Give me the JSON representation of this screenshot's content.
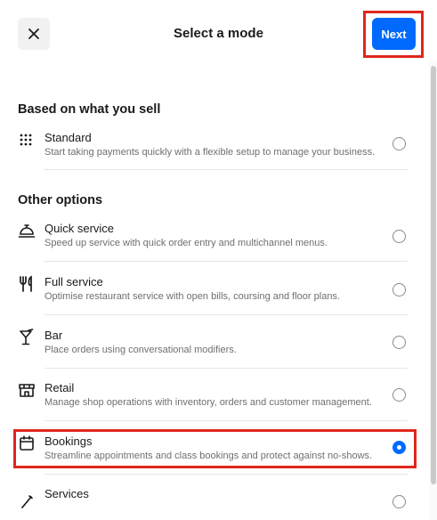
{
  "header": {
    "title": "Select a mode",
    "next_label": "Next"
  },
  "sections": [
    {
      "heading": "Based on what you sell",
      "options": [
        {
          "icon": "grid-dots-icon",
          "title": "Standard",
          "description": "Start taking payments quickly with a flexible setup to manage your business.",
          "selected": false
        }
      ]
    },
    {
      "heading": "Other options",
      "options": [
        {
          "icon": "service-bell-icon",
          "title": "Quick service",
          "description": "Speed up service with quick order entry and multichannel menus.",
          "selected": false
        },
        {
          "icon": "fork-knife-icon",
          "title": "Full service",
          "description": "Optimise restaurant service with open bills, coursing and floor plans.",
          "selected": false
        },
        {
          "icon": "cocktail-glass-icon",
          "title": "Bar",
          "description": "Place orders using conversational modifiers.",
          "selected": false
        },
        {
          "icon": "storefront-icon",
          "title": "Retail",
          "description": "Manage shop operations with inventory, orders and customer management.",
          "selected": false
        },
        {
          "icon": "calendar-icon",
          "title": "Bookings",
          "description": "Streamline appointments and class bookings and protect against no-shows.",
          "selected": true
        },
        {
          "icon": "pencil-icon",
          "title": "Services",
          "description": "",
          "selected": false
        }
      ]
    }
  ],
  "colors": {
    "accent": "#006aff",
    "highlight": "#e0261b",
    "muted_text": "#6f6f6f"
  }
}
